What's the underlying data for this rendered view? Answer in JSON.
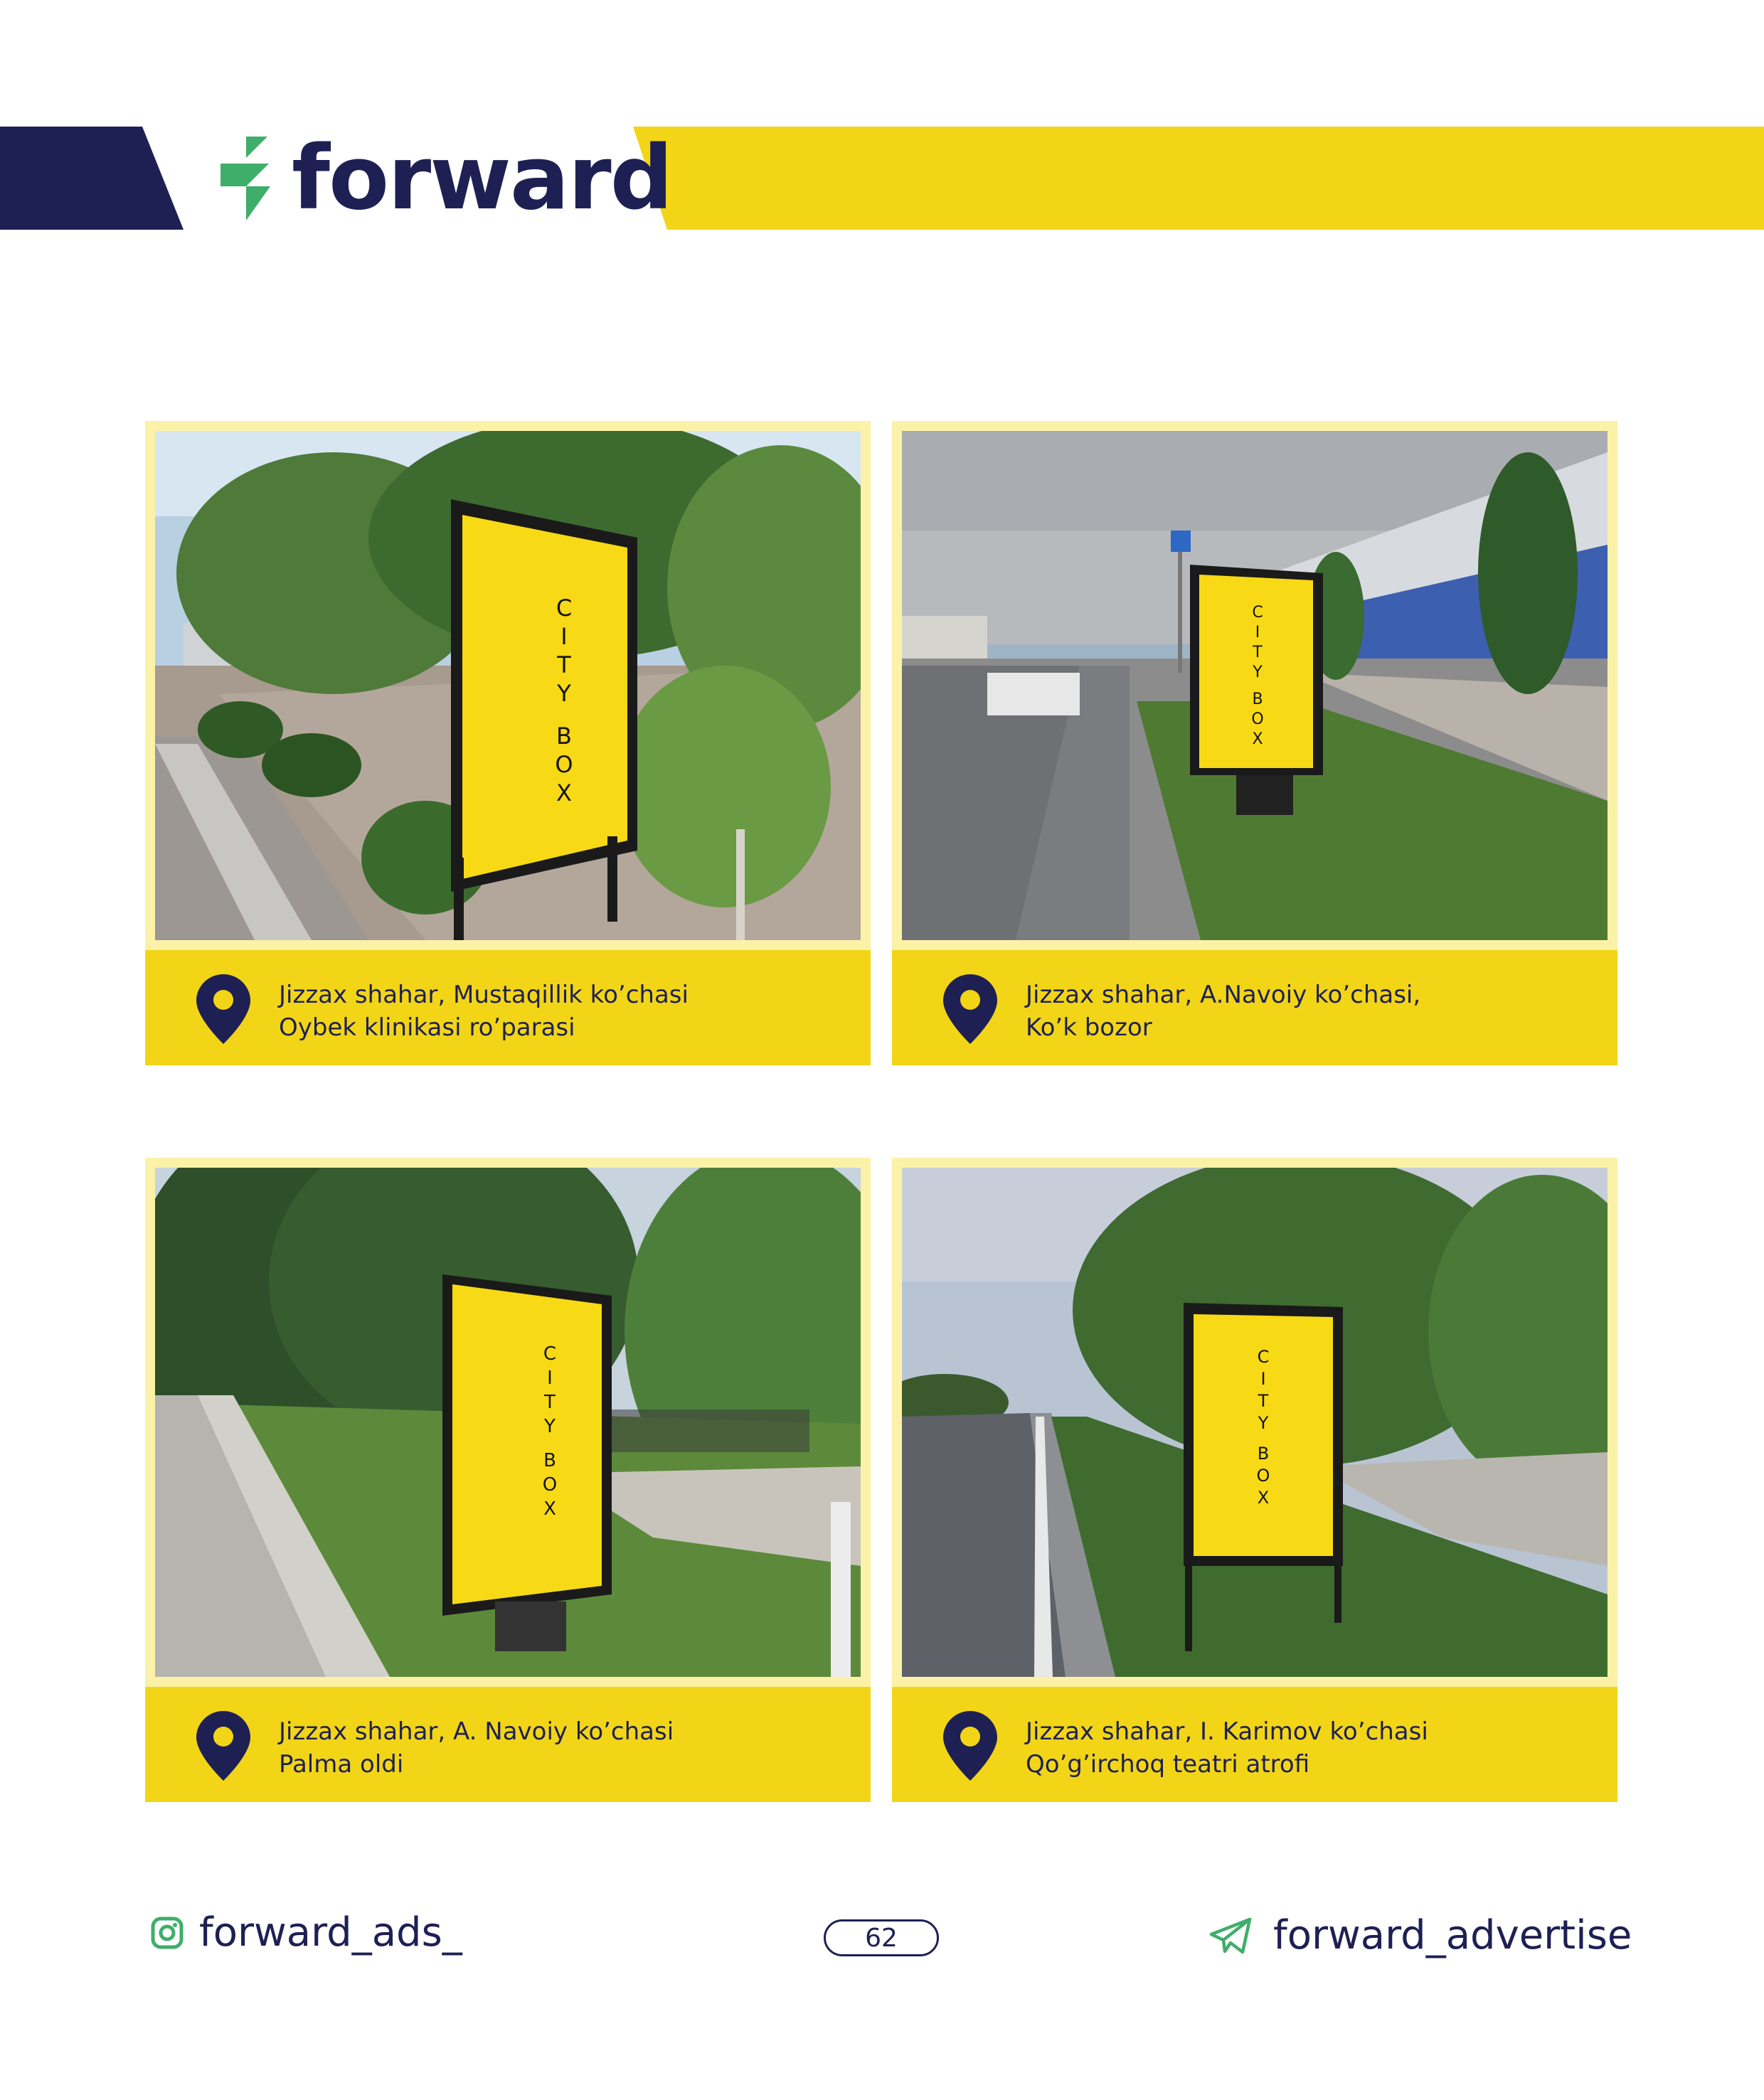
{
  "header": {
    "brand": "forward",
    "colors": {
      "navy": "#1e2054",
      "yellow": "#f2d517",
      "green": "#3fae6a"
    }
  },
  "cards": [
    {
      "sign_lines": [
        "C",
        "I",
        "T",
        "Y",
        "",
        "B",
        "O",
        "X"
      ],
      "location": [
        "Jizzax shahar, Mustaqillik ko’chasi",
        "Oybek klinikasi ro’parasi"
      ]
    },
    {
      "sign_lines": [
        "C",
        "I",
        "T",
        "Y",
        "",
        "B",
        "O",
        "X"
      ],
      "location": [
        "Jizzax shahar, A.Navoiy ko’chasi,",
        "Ko’k bozor"
      ]
    },
    {
      "sign_lines": [
        "C",
        "I",
        "T",
        "Y",
        "",
        "B",
        "O",
        "X"
      ],
      "location": [
        "Jizzax shahar, A. Navoiy ko’chasi",
        "Palma oldi"
      ]
    },
    {
      "sign_lines": [
        "C",
        "I",
        "T",
        "Y",
        "",
        "B",
        "O",
        "X"
      ],
      "location": [
        "Jizzax shahar, I. Karimov ko’chasi",
        "Qo’g’irchoq teatri atrofi"
      ]
    }
  ],
  "icons": {
    "location": "map-pin-icon",
    "instagram": "instagram-icon",
    "telegram": "telegram-icon"
  },
  "footer": {
    "instagram_handle": "forward_ads_",
    "page_number": "62",
    "telegram_handle": "forward_advertise"
  }
}
